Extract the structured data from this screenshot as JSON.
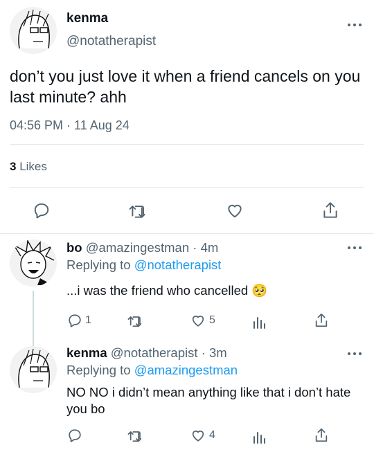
{
  "main_tweet": {
    "name": "kenma",
    "handle": "@notatherapist",
    "text": "don’t you just love it when a friend cancels on you last minute? ahh",
    "time": "04:56 PM · 11 Aug 24",
    "likes_count": "3",
    "likes_label": "Likes"
  },
  "replies": [
    {
      "name": "bo",
      "meta": "@amazingestman · 4m",
      "replying_prefix": "Replying to",
      "replying_to": "@notatherapist",
      "text": "...i was the friend who cancelled 🥺",
      "reply_count": "1",
      "retweet_count": "",
      "like_count": "5"
    },
    {
      "name": "kenma",
      "meta": "@notatherapist · 3m",
      "replying_prefix": "Replying to",
      "replying_to": "@amazingestman",
      "text": "NO NO i didn’t mean anything like that i don’t hate you bo",
      "reply_count": "",
      "retweet_count": "",
      "like_count": "4"
    }
  ],
  "colors": {
    "accent": "#1d9bf0",
    "secondary": "#536471",
    "text": "#0f1419"
  },
  "icons": [
    "reply-icon",
    "retweet-icon",
    "like-icon",
    "share-icon",
    "views-icon",
    "more-icon"
  ]
}
